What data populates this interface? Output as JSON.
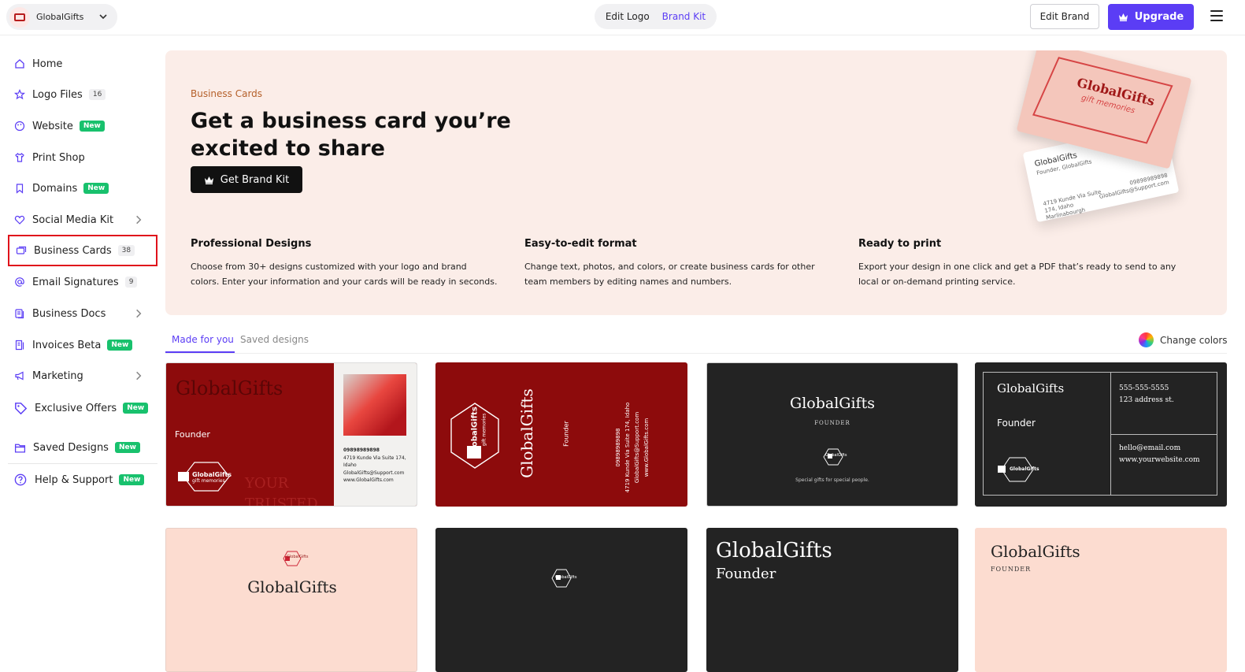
{
  "topbar": {
    "brand_name": "GlobalGifts",
    "edit_logo": "Edit Logo",
    "brand_kit": "Brand Kit",
    "edit_brand": "Edit Brand",
    "upgrade": "Upgrade"
  },
  "sidebar": {
    "items": [
      {
        "label": "Home",
        "icon": "home-icon"
      },
      {
        "label": "Logo Files",
        "count": "16",
        "icon": "star-icon"
      },
      {
        "label": "Website",
        "badge": "New",
        "icon": "palette-icon"
      },
      {
        "label": "Print Shop",
        "icon": "shirt-icon"
      },
      {
        "label": "Domains",
        "badge": "New",
        "icon": "bookmark-icon"
      },
      {
        "label": "Social Media Kit",
        "icon": "heart-icon"
      },
      {
        "label": "Business Cards",
        "count": "38",
        "icon": "cards-icon"
      },
      {
        "label": "Email Signatures",
        "count": "9",
        "icon": "at-icon"
      },
      {
        "label": "Business Docs",
        "icon": "docs-icon"
      },
      {
        "label": "Invoices Beta",
        "badge": "New",
        "icon": "invoice-icon"
      },
      {
        "label": "Marketing",
        "icon": "megaphone-icon"
      },
      {
        "label": "Exclusive Offers",
        "badge": "New",
        "icon": "tag-icon"
      },
      {
        "label": "Saved Designs",
        "badge": "New",
        "icon": "folder-icon"
      },
      {
        "label": "Help & Support",
        "badge": "New",
        "icon": "question-icon"
      }
    ]
  },
  "hero": {
    "kicker": "Business Cards",
    "title": "Get a business card you’re excited to share",
    "button": "Get Brand Kit",
    "features": [
      {
        "title": "Professional Designs",
        "desc": "Choose from 30+ designs customized with your logo and brand colors. Enter your information and your cards will be ready in seconds."
      },
      {
        "title": "Easy-to-edit format",
        "desc": "Change text, photos, and colors, or create business cards for other team members by editing names and numbers."
      },
      {
        "title": "Ready to print",
        "desc": "Export your design in one click and get a PDF that’s ready to send to any local or on-demand printing service."
      }
    ],
    "preview_front": {
      "name": "GlobalGifts",
      "tagline": "gift memories"
    },
    "preview_back": {
      "name": "GlobalGifts",
      "role": "Founder, GlobalGifts",
      "address": "4719 Kunde Via Suite 174, Idaho Marlinabourgh",
      "phone": "09898989898",
      "email": "GlobalGifts@Support.com"
    }
  },
  "tabs": {
    "made_for_you": "Made for you",
    "saved_designs": "Saved designs",
    "change_colors": "Change colors"
  },
  "cards": {
    "c1": {
      "name": "GlobalGifts",
      "role": "Founder",
      "logo": "GlobalGifts",
      "tag": "gift memories",
      "watermark": "YOUR TRUSTED",
      "phone": "09898989898",
      "address": "4719 Kunde Via Suite 174, Idaho",
      "email": "GlobalGifts@Support.com",
      "web": "www.GlobalGifts.com"
    },
    "c2": {
      "name": "GlobalGifts",
      "role": "Founder",
      "phone": "09898989898",
      "address": "4719 Kunde Via Suite 174, Idaho",
      "email": "GlobalGifts@Support.com",
      "web": "www.GlobalGifts.com",
      "logo": "GlobalGifts",
      "tag": "gift memories"
    },
    "c3": {
      "name": "GlobalGifts",
      "role": "FOUNDER",
      "mark": "GlobalGifts",
      "tagline": "Special gifts for special people."
    },
    "c4": {
      "name": "GlobalGifts",
      "role": "Founder",
      "phone": "555-555-5555",
      "address": "123 address st.",
      "email": "hello@email.com",
      "web": "www.yourwebsite.com",
      "logo": "GlobalGifts"
    },
    "c5": {
      "name": "GlobalGifts",
      "logo": "GlobalGifts"
    },
    "c6": {
      "logo": "GlobalGifts"
    },
    "c7": {
      "name": "GlobalGifts",
      "role": "Founder"
    },
    "c8": {
      "name": "GlobalGifts",
      "role": "FOUNDER"
    }
  },
  "colors": {
    "accent": "#5b3df5",
    "new_badge": "#18c16d",
    "card_red": "#8d0b0c",
    "card_dark": "#232323",
    "card_peach": "#fcdcd0",
    "hero_bg": "#fbede8",
    "highlight": "#e0121b"
  }
}
